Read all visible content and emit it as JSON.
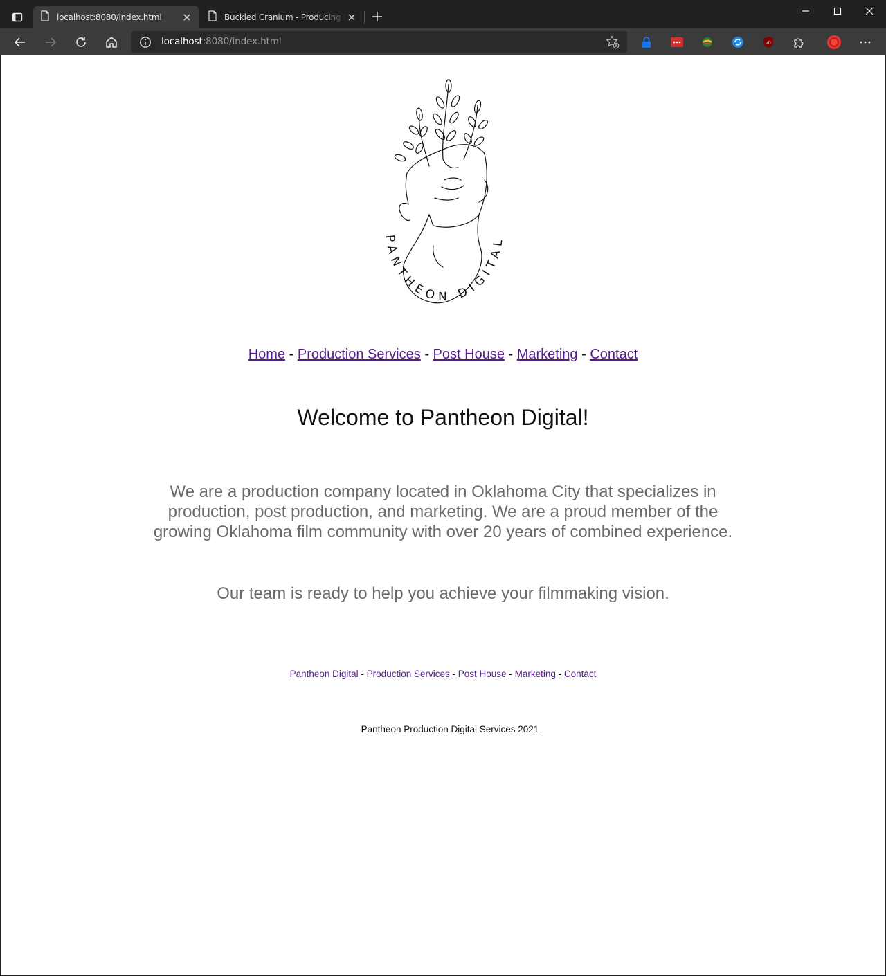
{
  "browser": {
    "tabs": [
      {
        "title": "localhost:8080/index.html",
        "active": true
      },
      {
        "title": "Buckled Cranium - Producing film",
        "active": false
      }
    ],
    "address": {
      "host": "localhost",
      "path": ":8080/index.html"
    },
    "icons": {
      "tab_actions": "tab-actions-icon",
      "page": "page-icon",
      "close": "close-icon",
      "new_tab": "plus-icon",
      "back": "back-arrow-icon",
      "forward": "forward-arrow-icon",
      "refresh": "refresh-icon",
      "home": "home-icon",
      "info": "info-icon",
      "favorites": "star-add-icon",
      "more": "more-icon"
    }
  },
  "page": {
    "logo_alt": "Pantheon Digital logo",
    "logo_text": "PANTHEON DIGITAL",
    "nav": [
      {
        "label": "Home"
      },
      {
        "label": "Production Services"
      },
      {
        "label": "Post House"
      },
      {
        "label": "Marketing"
      },
      {
        "label": "Contact"
      }
    ],
    "separator": "-",
    "heading": "Welcome to Pantheon Digital!",
    "intro": "We are a production company located in Oklahoma City that specializes in production, post production, and marketing. We are a proud member of the growing Oklahoma film community with over 20 years of combined experience.",
    "team": "Our team is ready to help you achieve your filmmaking vision.",
    "footer_nav": [
      {
        "label": "Pantheon Digital"
      },
      {
        "label": "Production Services"
      },
      {
        "label": "Post House"
      },
      {
        "label": "Marketing"
      },
      {
        "label": "Contact"
      }
    ],
    "copyright": "Pantheon Production Digital Services 2021"
  },
  "colors": {
    "link": "#551a8b",
    "body_text": "#6a6a6a",
    "chrome_dark": "#202020",
    "chrome_toolbar": "#3b3b3b"
  }
}
